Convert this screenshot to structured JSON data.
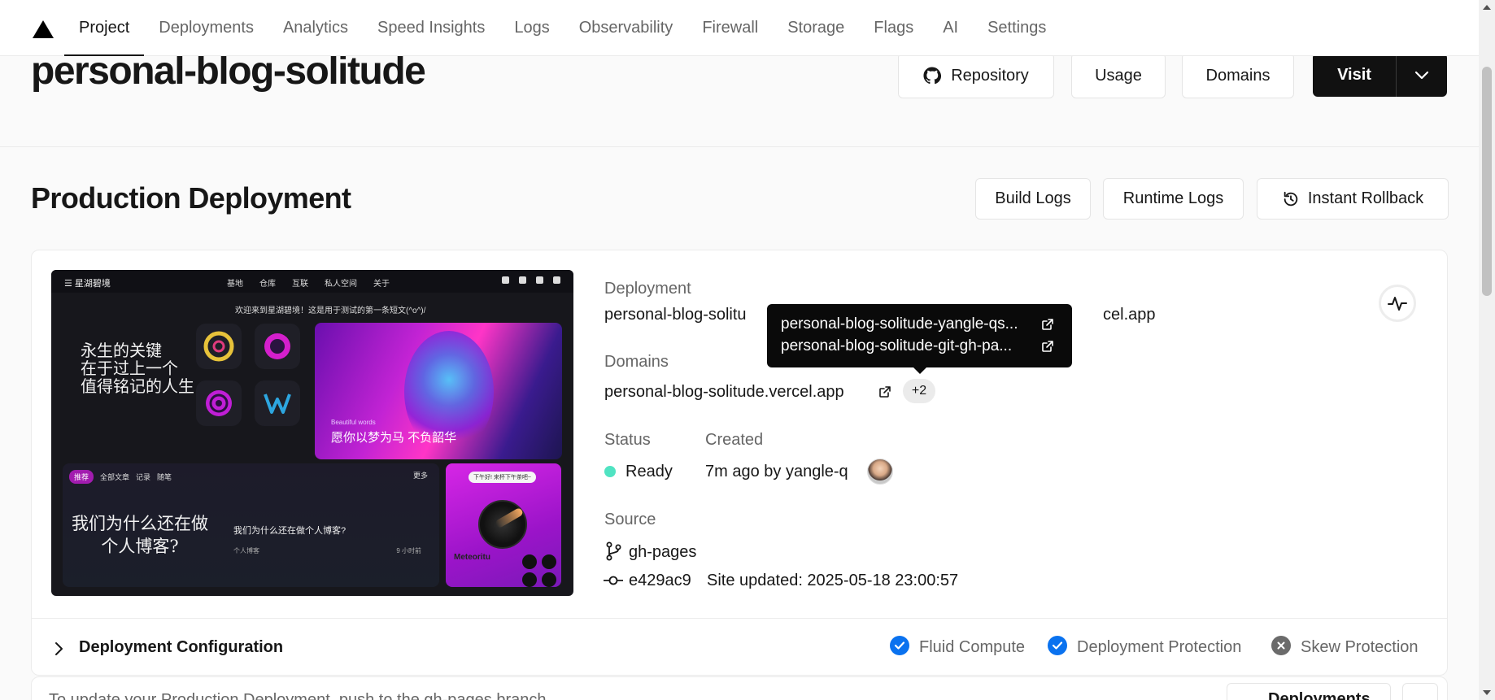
{
  "nav": {
    "tabs": [
      "Project",
      "Deployments",
      "Analytics",
      "Speed Insights",
      "Logs",
      "Observability",
      "Firewall",
      "Storage",
      "Flags",
      "AI",
      "Settings"
    ],
    "active_tab": "Project"
  },
  "header": {
    "title": "personal-blog-solitude",
    "repository_label": "Repository",
    "usage_label": "Usage",
    "domains_label": "Domains",
    "visit_label": "Visit"
  },
  "production": {
    "title": "Production Deployment",
    "build_logs_label": "Build Logs",
    "runtime_logs_label": "Runtime Logs",
    "instant_rollback_label": "Instant Rollback",
    "deployment_label": "Deployment",
    "deployment_url_start": "personal-blog-solitu",
    "deployment_url_end": "cel.app",
    "domains_label": "Domains",
    "domain_value": "personal-blog-solitude.vercel.app",
    "domains_more": "+2",
    "status_label": "Status",
    "status_value": "Ready",
    "created_label": "Created",
    "created_value": "7m ago by yangle-q",
    "source_label": "Source",
    "branch": "gh-pages",
    "commit_hash": "e429ac9",
    "commit_message": "Site updated: 2025-05-18 23:00:57"
  },
  "tooltip": {
    "items": [
      "personal-blog-solitude-yangle-qs...",
      "personal-blog-solitude-git-gh-pa..."
    ]
  },
  "preview": {
    "brand": "星湖碧境",
    "menu": [
      "基地",
      "仓库",
      "互联",
      "私人空间",
      "关于"
    ],
    "notice": "欢迎来到星湖碧境！这是用于测试的第一条短文(^o^)/",
    "slogan": "永生的关键\n在于过上一个\n值得铭记的人生",
    "hero_small": "Beautiful words",
    "hero_caption": "愿你以梦为马 不负韶华",
    "tabs": [
      "推荐",
      "全部文章",
      "记录",
      "随笔"
    ],
    "more": "更多",
    "big_title": "我们为什么还在做\n个人博客?",
    "post_title": "我们为什么还在做个人博客?",
    "post_meta": "个人博客",
    "post_time": "9 小时前",
    "side_pill": "下午好! 来杯下午茶吧~",
    "side_name": "Meteoritu"
  },
  "config": {
    "title": "Deployment Configuration",
    "features": [
      {
        "label": "Fluid Compute",
        "enabled": true
      },
      {
        "label": "Deployment Protection",
        "enabled": true
      },
      {
        "label": "Skew Protection",
        "enabled": false
      }
    ]
  },
  "bottom": {
    "text": "To update your Production Deployment, push to the gh-pages branch",
    "button_label": "Deployments"
  },
  "colors": {
    "accent_blue": "#0a72ef",
    "ready_green": "#50e3c2",
    "primary_dark": "#111111"
  }
}
